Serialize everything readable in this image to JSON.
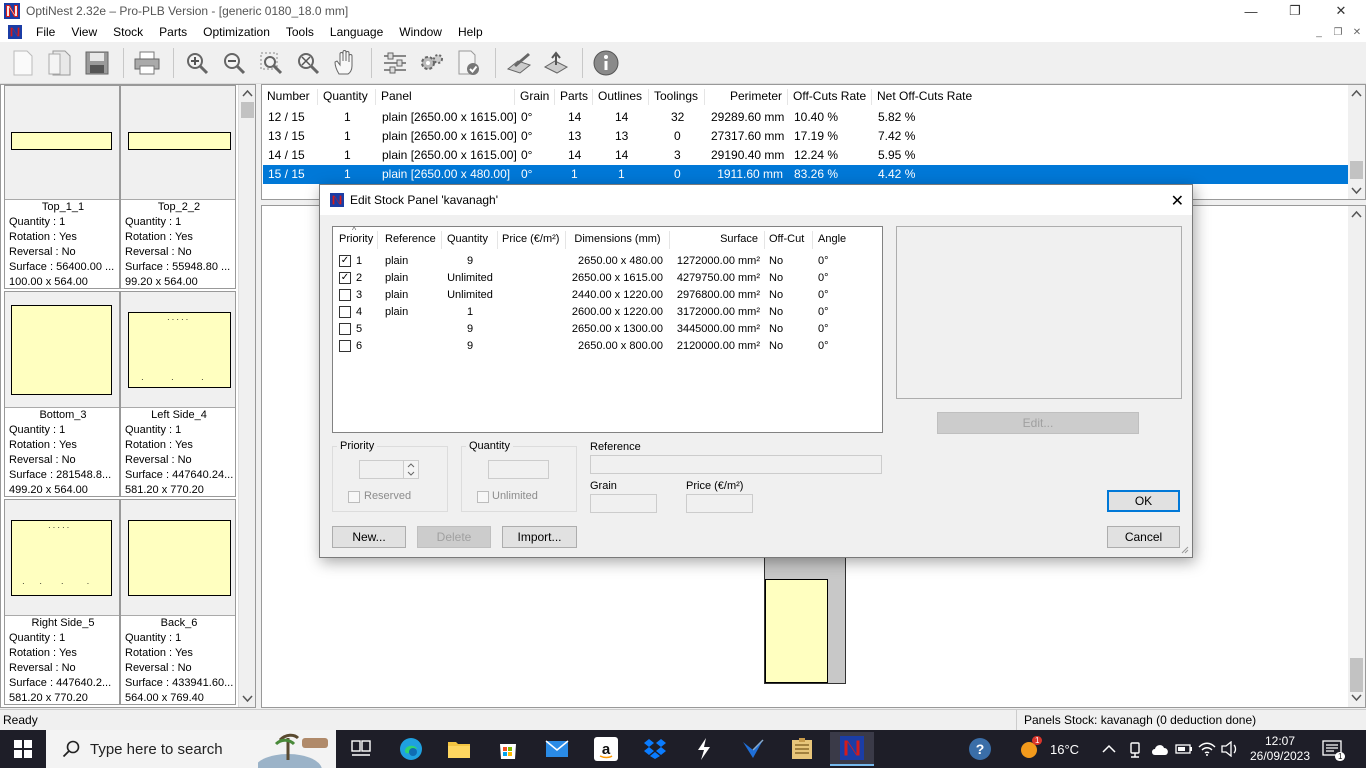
{
  "window": {
    "title": "OptiNest 2.32e – Pro-PLB Version - [generic 0180_18.0 mm]",
    "minimize": "—",
    "restore": "❐",
    "close": "✕"
  },
  "menu": {
    "items": [
      "File",
      "View",
      "Stock",
      "Parts",
      "Optimization",
      "Tools",
      "Language",
      "Window",
      "Help"
    ],
    "mdi": {
      "minimize": "_",
      "restore": "❐",
      "close": "✕"
    }
  },
  "toolbar": {
    "icons": [
      "new-document-icon",
      "open-document-icon",
      "save-icon",
      "print-icon",
      "zoom-in-icon",
      "zoom-out-icon",
      "zoom-window-icon",
      "zoom-fit-icon",
      "pan-hand-icon",
      "parameters-icon",
      "optimization-settings-icon",
      "validate-icon",
      "edit-notes-icon",
      "export-icon",
      "info-icon"
    ]
  },
  "parts": [
    {
      "name": "Top_1_1",
      "quantity": "Quantity : 1",
      "rotation": "Rotation : Yes",
      "reversal": "Reversal : No",
      "surface": "Surface : 56400.00 ...",
      "dims": "100.00 x 564.00"
    },
    {
      "name": "Top_2_2",
      "quantity": "Quantity : 1",
      "rotation": "Rotation : Yes",
      "reversal": "Reversal : No",
      "surface": "Surface : 55948.80 ...",
      "dims": "99.20 x 564.00"
    },
    {
      "name": "Bottom_3",
      "quantity": "Quantity : 1",
      "rotation": "Rotation : Yes",
      "reversal": "Reversal : No",
      "surface": "Surface : 281548.8...",
      "dims": "499.20 x 564.00"
    },
    {
      "name": "Left Side_4",
      "quantity": "Quantity : 1",
      "rotation": "Rotation : Yes",
      "reversal": "Reversal : No",
      "surface": "Surface : 447640.24...",
      "dims": "581.20 x 770.20"
    },
    {
      "name": "Right Side_5",
      "quantity": "Quantity : 1",
      "rotation": "Rotation : Yes",
      "reversal": "Reversal : No",
      "surface": "Surface : 447640.2...",
      "dims": "581.20 x 770.20"
    },
    {
      "name": "Back_6",
      "quantity": "Quantity : 1",
      "rotation": "Rotation : Yes",
      "reversal": "Reversal : No",
      "surface": "Surface : 433941.60...",
      "dims": "564.00 x 769.40"
    }
  ],
  "list": {
    "headers": [
      "Number",
      "Quantity",
      "Panel",
      "Grain",
      "Parts",
      "Outlines",
      "Toolings",
      "Perimeter",
      "Off-Cuts Rate",
      "Net Off-Cuts Rate"
    ],
    "rows": [
      {
        "number": "12 / 15",
        "quantity": "1",
        "panel": "plain [2650.00 x 1615.00]",
        "grain": "0°",
        "parts": "14",
        "outlines": "14",
        "toolings": "32",
        "perimeter": "29289.60 mm",
        "offcuts": "10.40 %",
        "net": "5.82 %"
      },
      {
        "number": "13 / 15",
        "quantity": "1",
        "panel": "plain [2650.00 x 1615.00]",
        "grain": "0°",
        "parts": "13",
        "outlines": "13",
        "toolings": "0",
        "perimeter": "27317.60 mm",
        "offcuts": "17.19 %",
        "net": "7.42 %"
      },
      {
        "number": "14 / 15",
        "quantity": "1",
        "panel": "plain [2650.00 x 1615.00]",
        "grain": "0°",
        "parts": "14",
        "outlines": "14",
        "toolings": "3",
        "perimeter": "29190.40 mm",
        "offcuts": "12.24 %",
        "net": "5.95 %"
      },
      {
        "number": "15 / 15",
        "quantity": "1",
        "panel": "plain [2650.00 x 480.00]",
        "grain": "0°",
        "parts": "1",
        "outlines": "1",
        "toolings": "0",
        "perimeter": "1911.60 mm",
        "offcuts": "83.26 %",
        "net": "4.42 %"
      }
    ]
  },
  "dialog": {
    "title": "Edit Stock Panel 'kavanagh'",
    "close": "✕",
    "sort_indicator": "^",
    "table_headers": [
      "Priority",
      "Reference",
      "Quantity",
      "Price (€/m²)",
      "Dimensions (mm)",
      "Surface",
      "Off-Cut",
      "Angle"
    ],
    "rows": [
      {
        "checked": true,
        "priority": "1",
        "reference": "plain",
        "quantity": "9",
        "price": "",
        "dims": "2650.00 x 480.00",
        "surface": "1272000.00 mm²",
        "offcut": "No",
        "angle": "0°"
      },
      {
        "checked": true,
        "priority": "2",
        "reference": "plain",
        "quantity": "Unlimited",
        "price": "",
        "dims": "2650.00 x 1615.00",
        "surface": "4279750.00 mm²",
        "offcut": "No",
        "angle": "0°"
      },
      {
        "checked": false,
        "priority": "3",
        "reference": "plain",
        "quantity": "Unlimited",
        "price": "",
        "dims": "2440.00 x 1220.00",
        "surface": "2976800.00 mm²",
        "offcut": "No",
        "angle": "0°"
      },
      {
        "checked": false,
        "priority": "4",
        "reference": "plain",
        "quantity": "1",
        "price": "",
        "dims": "2600.00 x 1220.00",
        "surface": "3172000.00 mm²",
        "offcut": "No",
        "angle": "0°"
      },
      {
        "checked": false,
        "priority": "5",
        "reference": "",
        "quantity": "9",
        "price": "",
        "dims": "2650.00 x 1300.00",
        "surface": "3445000.00 mm²",
        "offcut": "No",
        "angle": "0°"
      },
      {
        "checked": false,
        "priority": "6",
        "reference": "",
        "quantity": "9",
        "price": "",
        "dims": "2650.00 x 800.00",
        "surface": "2120000.00 mm²",
        "offcut": "No",
        "angle": "0°"
      }
    ],
    "edit_label": "Edit...",
    "priority_label": "Priority",
    "reserved_label": "Reserved",
    "quantity_label": "Quantity",
    "unlimited_label": "Unlimited",
    "reference_label": "Reference",
    "grain_label": "Grain",
    "price_label": "Price (€/m²)",
    "new_label": "New...",
    "delete_label": "Delete",
    "import_label": "Import...",
    "ok_label": "OK",
    "cancel_label": "Cancel"
  },
  "status": {
    "left": "Ready",
    "right": "Panels Stock: kavanagh (0 deduction done)"
  },
  "taskbar": {
    "search_placeholder": "Type here to search",
    "weather": "16°C",
    "weather_badge": "1",
    "time": "12:07",
    "date": "26/09/2023",
    "notifications_badge": "1"
  },
  "colors": {
    "accent": "#0078d7",
    "part_fill": "#ffffc0",
    "taskbar": "#1e1e28",
    "logo_red": "#d41c1c",
    "logo_blue": "#1b3da6"
  }
}
